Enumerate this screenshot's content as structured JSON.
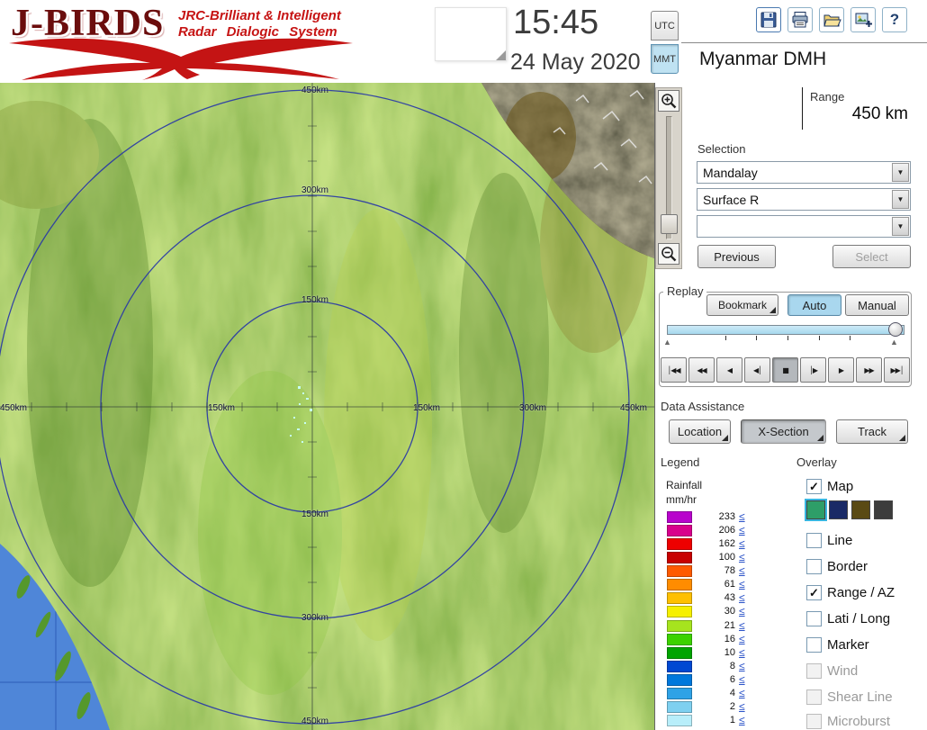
{
  "colors": {
    "brand_red": "#c41414",
    "accent_blue": "#a9d7ee",
    "link_blue": "#2a52c8",
    "ring_blue": "#2736a8"
  },
  "icons": {
    "check": "✓",
    "dropdown_arrow": "▼",
    "help": "?",
    "slider_marker": "▲",
    "toolbar": [
      "floppy-save-icon",
      "printer-icon",
      "open-folder-icon",
      "snapshot-icon",
      "help-icon"
    ]
  },
  "header": {
    "logo_title": "J-BIRDS",
    "logo_sub1": "JRC-Brilliant & Intelligent",
    "logo_sub2": "Radar Dialogic System",
    "time": "15:45",
    "date": "24 May 2020",
    "tz_utc": "UTC",
    "tz_mmt": "MMT",
    "tz_selected": "MMT",
    "station": "Myanmar DMH"
  },
  "map": {
    "labels": {
      "top": [
        "450km",
        "300km",
        "150km"
      ],
      "left": [
        "450km",
        "150km"
      ],
      "right": [
        "150km",
        "300km",
        "450km"
      ],
      "bottom": [
        "150km",
        "300km",
        "450km"
      ]
    }
  },
  "panel": {
    "range_label": "Range",
    "range_value": "450 km",
    "selection_label": "Selection",
    "dropdown1": "Mandalay",
    "dropdown2": "Surface R",
    "dropdown3": "",
    "previous_btn": "Previous",
    "select_btn": "Select",
    "replay": {
      "title": "Replay",
      "bookmark_btn": "Bookmark",
      "auto_btn": "Auto",
      "manual_btn": "Manual",
      "mode_selected": "Auto",
      "transport": [
        "│◀◀",
        "◀◀",
        "◀",
        "◀│",
        "■",
        "│▶",
        "▶",
        "▶▶",
        "▶▶│"
      ],
      "transport_active": "stop"
    },
    "data_assistance": {
      "title": "Data Assistance",
      "location_btn": "Location",
      "xsection_btn": "X-Section",
      "track_btn": "Track",
      "active": "X-Section"
    },
    "legend": {
      "title": "Legend",
      "unit_line1": "Rainfall",
      "unit_line2": "mm/hr",
      "le": "≤",
      "rows": [
        {
          "color": "#b804cc",
          "value": "233"
        },
        {
          "color": "#d8008c",
          "value": "206"
        },
        {
          "color": "#ee0000",
          "value": "162"
        },
        {
          "color": "#c80000",
          "value": "100"
        },
        {
          "color": "#ff5a00",
          "value": "78"
        },
        {
          "color": "#ff8c00",
          "value": "61"
        },
        {
          "color": "#ffc000",
          "value": "43"
        },
        {
          "color": "#f6f000",
          "value": "30"
        },
        {
          "color": "#a6e41e",
          "value": "21"
        },
        {
          "color": "#3cd200",
          "value": "16"
        },
        {
          "color": "#00a400",
          "value": "10"
        },
        {
          "color": "#0048d2",
          "value": "8"
        },
        {
          "color": "#0078dc",
          "value": "6"
        },
        {
          "color": "#2ea2e6",
          "value": "4"
        },
        {
          "color": "#7ed0f0",
          "value": "2"
        },
        {
          "color": "#b8eefa",
          "value": "1"
        }
      ]
    },
    "overlay": {
      "title": "Overlay",
      "items": [
        {
          "label": "Map",
          "checked": true,
          "enabled": true
        },
        {
          "label": "Line",
          "checked": false,
          "enabled": true
        },
        {
          "label": "Border",
          "checked": false,
          "enabled": true
        },
        {
          "label": "Range / AZ",
          "checked": true,
          "enabled": true
        },
        {
          "label": "Lati / Long",
          "checked": false,
          "enabled": true
        },
        {
          "label": "Marker",
          "checked": false,
          "enabled": true
        },
        {
          "label": "Wind",
          "checked": false,
          "enabled": false
        },
        {
          "label": "Shear Line",
          "checked": false,
          "enabled": false
        },
        {
          "label": "Microburst",
          "checked": false,
          "enabled": false
        }
      ],
      "map_styles": [
        "#2e9e68",
        "#1a2a66",
        "#5a4a14",
        "#3c3c3c"
      ],
      "map_style_selected": 0
    }
  }
}
